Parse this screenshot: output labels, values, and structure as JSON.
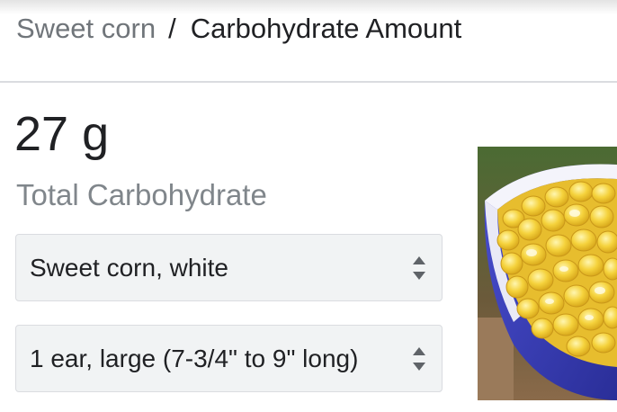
{
  "breadcrumb": {
    "parent": "Sweet corn",
    "separator": "/",
    "current": "Carbohydrate Amount"
  },
  "nutrient": {
    "amount": "27 g",
    "label": "Total Carbohydrate"
  },
  "food_select": {
    "selected": "Sweet corn, white"
  },
  "serving_select": {
    "selected": "1 ear, large (7-3/4\" to 9\" long)"
  },
  "colors": {
    "bowl": "#3a3fb8",
    "corn": "#f3cf3a",
    "select_bg": "#f1f3f4",
    "muted_text": "#70757a"
  },
  "icons": {
    "select_arrows": "up-down-arrows-icon"
  }
}
